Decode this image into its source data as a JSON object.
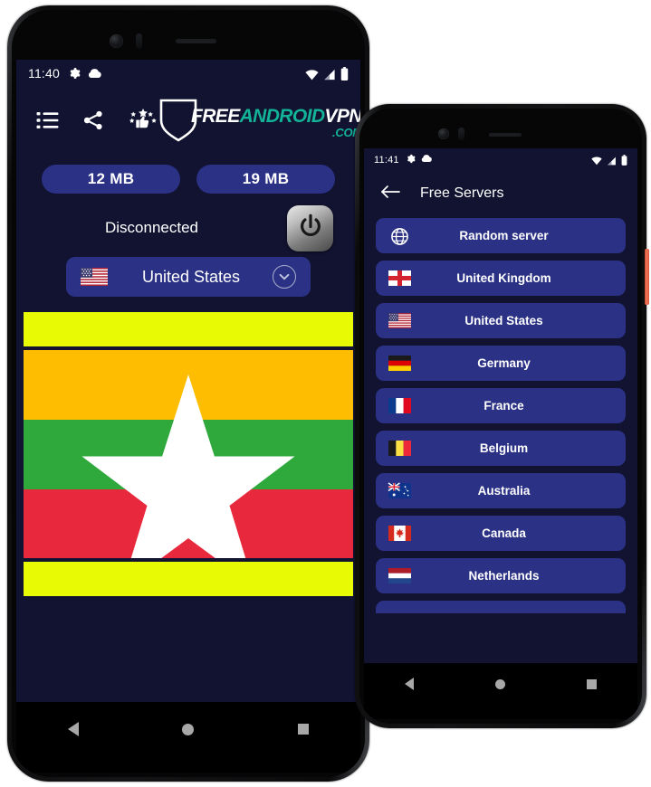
{
  "page": {
    "background": "#ffffff"
  },
  "colors": {
    "screen_bg": "#111331",
    "card_blue": "#2b3185",
    "accent_teal": "#12b396",
    "banner_yellow": "#e8fb05",
    "text_white": "#ffffff"
  },
  "phone_left": {
    "status_bar": {
      "time": "11:40",
      "icons_left": [
        "gear-icon",
        "cloud-icon"
      ],
      "icons_right": [
        "wifi-icon",
        "signal-icon",
        "battery-icon"
      ]
    },
    "toolbar": {
      "icons": [
        {
          "name": "list-icon",
          "label": "List"
        },
        {
          "name": "share-icon",
          "label": "Share"
        },
        {
          "name": "rate-icon",
          "label": "Rate"
        }
      ],
      "logo": {
        "part1": "FREE",
        "part2": "ANDROID",
        "part3": "VPN",
        "part4": ".COM"
      }
    },
    "usage": {
      "download": "12 MB",
      "upload": "19 MB"
    },
    "connection": {
      "status": "Disconnected",
      "power_button_label": "power-icon"
    },
    "selected_server": {
      "flag": "us",
      "name": "United States",
      "chevron": "chevron-down-icon"
    },
    "banner": {
      "flag": "mm",
      "color": "#e8fb05"
    },
    "nav_bar": [
      "back-button",
      "home-button",
      "recents-button"
    ]
  },
  "phone_right": {
    "status_bar": {
      "time": "11:41",
      "icons_left": [
        "gear-icon",
        "cloud-icon"
      ],
      "icons_right": [
        "wifi-icon",
        "signal-icon",
        "battery-icon"
      ]
    },
    "app_bar": {
      "back": "back-arrow-icon",
      "title": "Free Servers"
    },
    "servers": [
      {
        "flag": "globe",
        "name": "Random server"
      },
      {
        "flag": "gb",
        "name": "United Kingdom"
      },
      {
        "flag": "us",
        "name": "United States"
      },
      {
        "flag": "de",
        "name": "Germany"
      },
      {
        "flag": "fr",
        "name": "France"
      },
      {
        "flag": "be",
        "name": "Belgium"
      },
      {
        "flag": "au",
        "name": "Australia"
      },
      {
        "flag": "ca",
        "name": "Canada"
      },
      {
        "flag": "nl",
        "name": "Netherlands"
      }
    ],
    "nav_bar": [
      "back-button",
      "home-button",
      "recents-button"
    ]
  }
}
